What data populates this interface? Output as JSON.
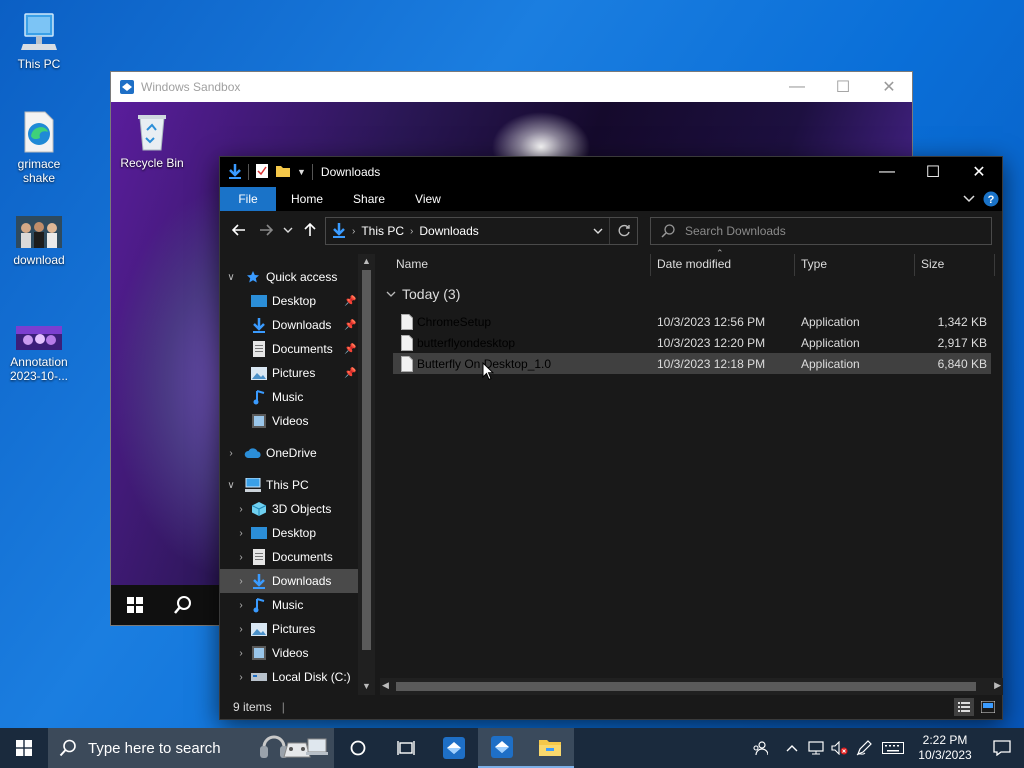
{
  "desktop": {
    "icons": [
      {
        "label": "This PC"
      },
      {
        "label": "grimace shake"
      },
      {
        "label": "download"
      },
      {
        "label": "Annotation 2023-10-..."
      }
    ]
  },
  "sandbox": {
    "title": "Windows Sandbox",
    "recycle_bin_label": "Recycle Bin"
  },
  "explorer": {
    "title": "Downloads",
    "ribbon": {
      "file": "File",
      "home": "Home",
      "share": "Share",
      "view": "View"
    },
    "address": {
      "root": "This PC",
      "current": "Downloads"
    },
    "search": {
      "placeholder": "Search Downloads"
    },
    "nav": {
      "quick_access": "Quick access",
      "quick_items": [
        {
          "label": "Desktop",
          "icon": "desktop-folder-icon",
          "pinned": true
        },
        {
          "label": "Downloads",
          "icon": "downloads-folder-icon",
          "pinned": true
        },
        {
          "label": "Documents",
          "icon": "documents-folder-icon",
          "pinned": true
        },
        {
          "label": "Pictures",
          "icon": "pictures-folder-icon",
          "pinned": true
        },
        {
          "label": "Music",
          "icon": "music-folder-icon",
          "pinned": false
        },
        {
          "label": "Videos",
          "icon": "videos-folder-icon",
          "pinned": false
        }
      ],
      "onedrive": "OneDrive",
      "this_pc": "This PC",
      "pc_items": [
        {
          "label": "3D Objects",
          "icon": "3d-objects-icon"
        },
        {
          "label": "Desktop",
          "icon": "desktop-folder-icon"
        },
        {
          "label": "Documents",
          "icon": "documents-folder-icon"
        },
        {
          "label": "Downloads",
          "icon": "downloads-folder-icon",
          "selected": true
        },
        {
          "label": "Music",
          "icon": "music-folder-icon"
        },
        {
          "label": "Pictures",
          "icon": "pictures-folder-icon"
        },
        {
          "label": "Videos",
          "icon": "videos-folder-icon"
        },
        {
          "label": "Local Disk (C:)",
          "icon": "drive-icon"
        }
      ]
    },
    "columns": {
      "name": "Name",
      "date": "Date modified",
      "type": "Type",
      "size": "Size"
    },
    "group": "Today (3)",
    "files": [
      {
        "name": "ChromeSetup",
        "date": "10/3/2023 12:56 PM",
        "type": "Application",
        "size": "1,342 KB"
      },
      {
        "name": "butterflyondesktop",
        "date": "10/3/2023 12:20 PM",
        "type": "Application",
        "size": "2,917 KB"
      },
      {
        "name": "Butterfly On Desktop_1.0",
        "date": "10/3/2023 12:18 PM",
        "type": "Application",
        "size": "6,840 KB",
        "selected": true
      }
    ],
    "status": "9 items"
  },
  "taskbar": {
    "search_placeholder": "Type here to search",
    "clock_time": "2:22 PM",
    "clock_date": "10/3/2023"
  }
}
